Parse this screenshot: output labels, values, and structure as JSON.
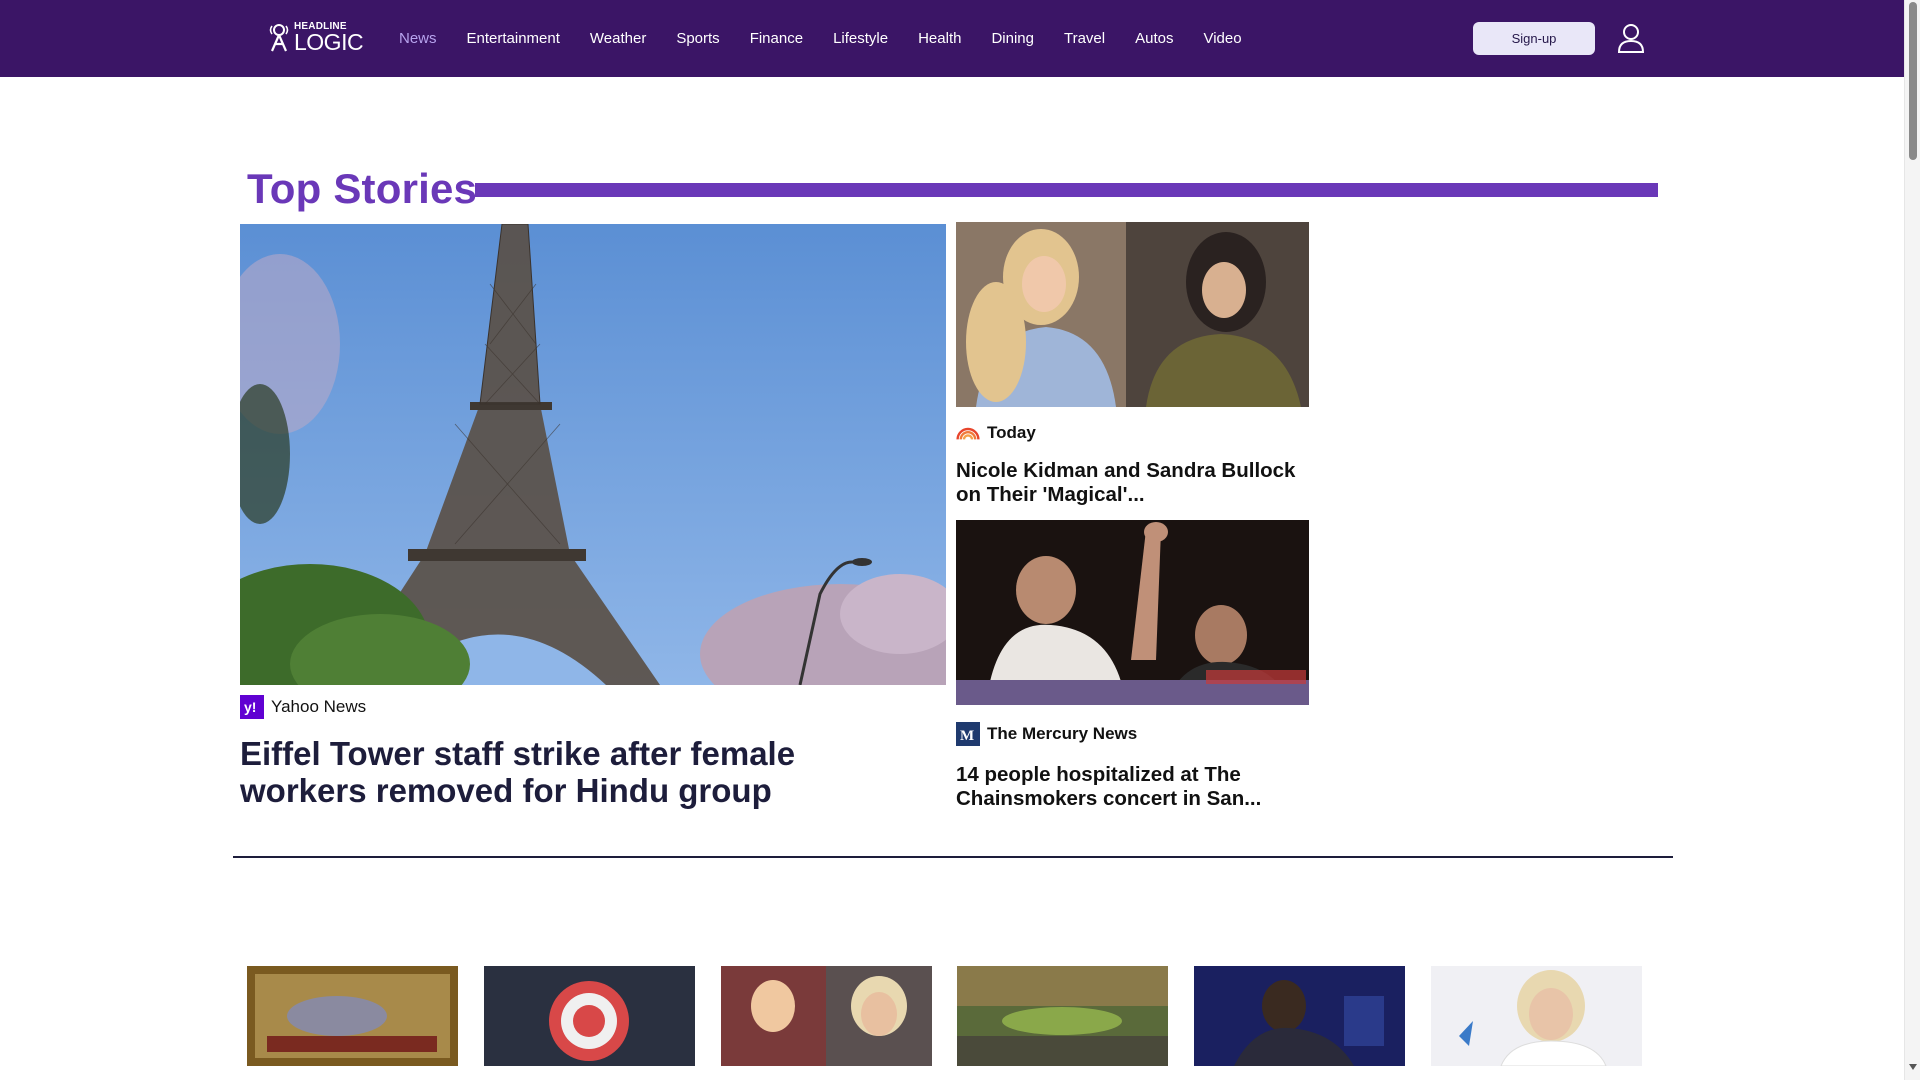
{
  "brand": {
    "logo_top": "HEADLINE",
    "logo_bottom": "LOGIC"
  },
  "nav": {
    "items": [
      {
        "label": "News",
        "active": true
      },
      {
        "label": "Entertainment"
      },
      {
        "label": "Weather"
      },
      {
        "label": "Sports"
      },
      {
        "label": "Finance"
      },
      {
        "label": "Lifestyle"
      },
      {
        "label": "Health"
      },
      {
        "label": "Dining"
      },
      {
        "label": "Travel"
      },
      {
        "label": "Autos"
      },
      {
        "label": "Video"
      }
    ],
    "signup_label": "Sign-up",
    "user_icon": "user-icon"
  },
  "top_stories": {
    "title": "Top Stories",
    "main": {
      "source": "Yahoo News",
      "source_icon": "yahoo-icon",
      "headline": "Eiffel Tower staff strike after female workers removed for Hindu group"
    },
    "side": [
      {
        "source": "Today",
        "source_icon": "today-rainbow-icon",
        "headline": "Nicole Kidman and Sandra Bullock on Their 'Magical'..."
      },
      {
        "source": "The Mercury News",
        "source_icon": "mercury-news-icon",
        "headline": "14 people hospitalized at The Chainsmokers concert in San..."
      }
    ]
  },
  "colors": {
    "nav_bg": "#3b1566",
    "accent": "#6a38b8",
    "active_link": "#b7a4ee"
  }
}
